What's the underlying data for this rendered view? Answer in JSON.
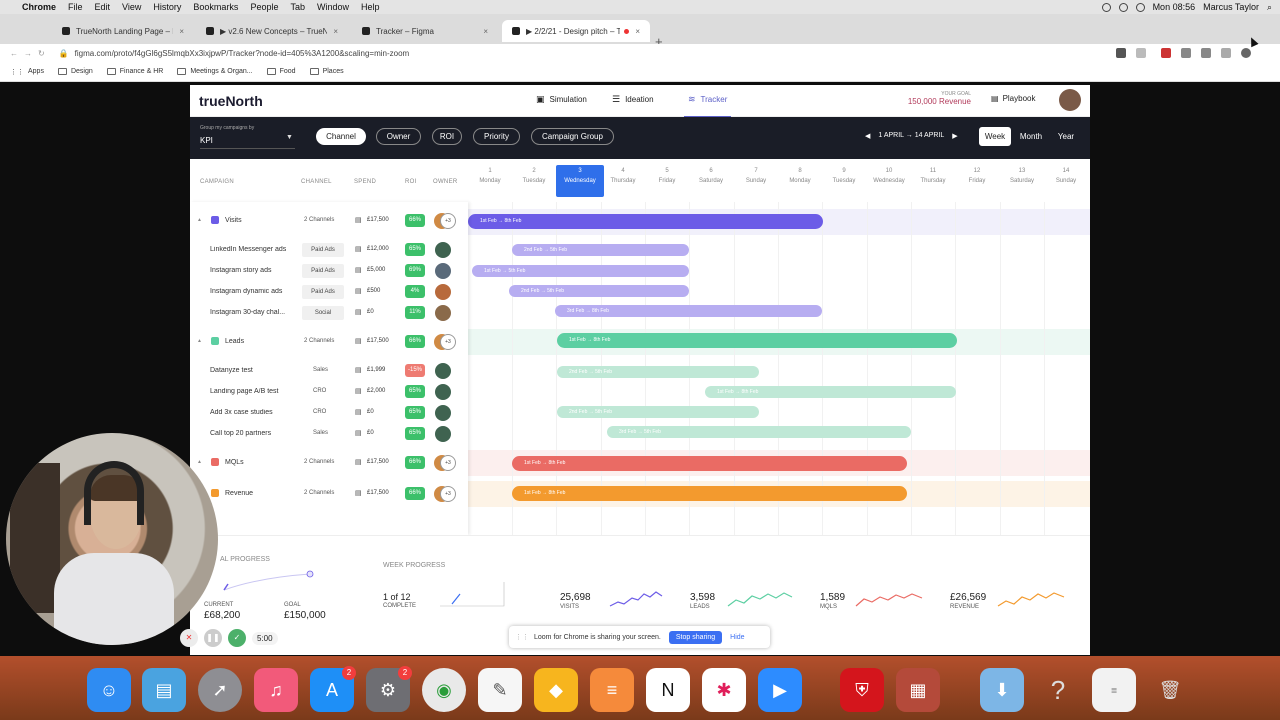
{
  "menubar": {
    "app": "Chrome",
    "items": [
      "File",
      "Edit",
      "View",
      "History",
      "Bookmarks",
      "People",
      "Tab",
      "Window",
      "Help"
    ],
    "clock": "Mon 08:56",
    "user": "Marcus Taylor"
  },
  "browser": {
    "tabs": [
      {
        "title": "TrueNorth Landing Page – Figma"
      },
      {
        "title": "▶ v2.6 New Concepts – TrueNorth"
      },
      {
        "title": "Tracker – Figma"
      },
      {
        "title": "▶ 2/2/21 - Design pitch – Tr"
      }
    ],
    "url": "figma.com/proto/f4gGl6gS5lmqbXx3ixjpwP/Tracker?node-id=405%3A1200&scaling=min-zoom",
    "bookmarks": [
      "Apps",
      "Design",
      "Finance & HR",
      "Meetings & Organ...",
      "Food",
      "Places"
    ]
  },
  "app": {
    "logo": "trueNorth",
    "nav": [
      "Simulation",
      "Ideation",
      "Tracker"
    ],
    "goal_label": "YOUR GOAL",
    "goal_value": "150,000 Revenue",
    "playbook": "Playbook",
    "group_label": "Group my campaigns by",
    "group_value": "KPI",
    "filters": [
      "Channel",
      "Owner",
      "ROI",
      "Priority",
      "Campaign Group"
    ],
    "date_range": "1 APRIL → 14 APRIL",
    "views": [
      "Week",
      "Month",
      "Year"
    ],
    "columns": [
      "CAMPAIGN",
      "CHANNEL",
      "SPEND",
      "ROI",
      "OWNER"
    ],
    "days": [
      {
        "n": "1",
        "d": "Monday"
      },
      {
        "n": "2",
        "d": "Tuesday"
      },
      {
        "n": "3",
        "d": "Wednesday"
      },
      {
        "n": "4",
        "d": "Thursday"
      },
      {
        "n": "5",
        "d": "Friday"
      },
      {
        "n": "6",
        "d": "Saturday"
      },
      {
        "n": "7",
        "d": "Sunday"
      },
      {
        "n": "8",
        "d": "Monday"
      },
      {
        "n": "9",
        "d": "Tuesday"
      },
      {
        "n": "10",
        "d": "Wednesday"
      },
      {
        "n": "11",
        "d": "Thursday"
      },
      {
        "n": "12",
        "d": "Friday"
      },
      {
        "n": "13",
        "d": "Saturday"
      },
      {
        "n": "14",
        "d": "Sunday"
      }
    ],
    "groups": {
      "visits": {
        "name": "Visits",
        "channels": "2 Channels",
        "spend": "£17,500",
        "roi": "66%",
        "owners": "+3",
        "bar": "1st Feb → 8th Feb",
        "color": "#6c5ce7"
      },
      "leads": {
        "name": "Leads",
        "channels": "2 Channels",
        "spend": "£17,500",
        "roi": "66%",
        "owners": "+3",
        "bar": "1st Feb → 8th Feb",
        "color": "#5ccfa2"
      },
      "mqls": {
        "name": "MQLs",
        "channels": "2 Channels",
        "spend": "£17,500",
        "roi": "66%",
        "owners": "+3",
        "bar": "1st Feb → 8th Feb",
        "color": "#ea6b64"
      },
      "revenue": {
        "name": "Revenue",
        "channels": "2 Channels",
        "spend": "£17,500",
        "roi": "66%",
        "owners": "+3",
        "bar": "1st Feb → 8th Feb",
        "color": "#f39a2e"
      }
    },
    "campaigns": [
      {
        "name": "LinkedIn Messenger ads",
        "channel": "Paid Ads",
        "spend": "£12,000",
        "roi": "65%",
        "bar": "2nd Feb → 5th Feb"
      },
      {
        "name": "Instagram story ads",
        "channel": "Paid Ads",
        "spend": "£5,000",
        "roi": "69%",
        "bar": "1st Feb → 5th Feb"
      },
      {
        "name": "Instagram dynamic ads",
        "channel": "Paid Ads",
        "spend": "£500",
        "roi": "4%",
        "bar": "2nd Feb → 5th Feb"
      },
      {
        "name": "Instagram 30-day chal...",
        "channel": "Social",
        "spend": "£0",
        "roi": "11%",
        "bar": "3rd Feb → 8th Feb"
      },
      {
        "name": "Datanyze test",
        "channel": "Sales",
        "spend": "£1,999",
        "roi": "-15%",
        "bar": "2nd Feb → 5th Feb"
      },
      {
        "name": "Landing page A/B test",
        "channel": "CRO",
        "spend": "£2,000",
        "roi": "65%",
        "bar": "1st Feb → 8th Feb"
      },
      {
        "name": "Add 3x case studies",
        "channel": "CRO",
        "spend": "£0",
        "roi": "65%",
        "bar": "2nd Feb → 5th Feb"
      },
      {
        "name": "Call top 20 partners",
        "channel": "Sales",
        "spend": "£0",
        "roi": "65%",
        "bar": "3rd Feb → 5th Feb"
      }
    ],
    "progress": {
      "goal_progress_label": "AL PROGRESS",
      "current_label": "CURRENT",
      "current_value": "£68,200",
      "goal_label": "GOAL",
      "goal_value": "£150,000",
      "week_label": "WEEK PROGRESS",
      "week_value": "1 of 12",
      "week_sub": "COMPLETE",
      "kpis": [
        {
          "value": "25,698",
          "label": "VISITS",
          "color": "#6c5ce7"
        },
        {
          "value": "3,598",
          "label": "LEADS",
          "color": "#5ccfa2"
        },
        {
          "value": "1,589",
          "label": "MQLS",
          "color": "#ea6b64"
        },
        {
          "value": "£26,569",
          "label": "REVENUE",
          "color": "#f39a2e"
        }
      ]
    }
  },
  "loom": {
    "text": "Loom for Chrome is sharing your screen.",
    "stop": "Stop sharing",
    "hide": "Hide"
  },
  "recorder": {
    "time": "5:00"
  },
  "dock": {
    "badges": [
      "2",
      "2"
    ]
  }
}
